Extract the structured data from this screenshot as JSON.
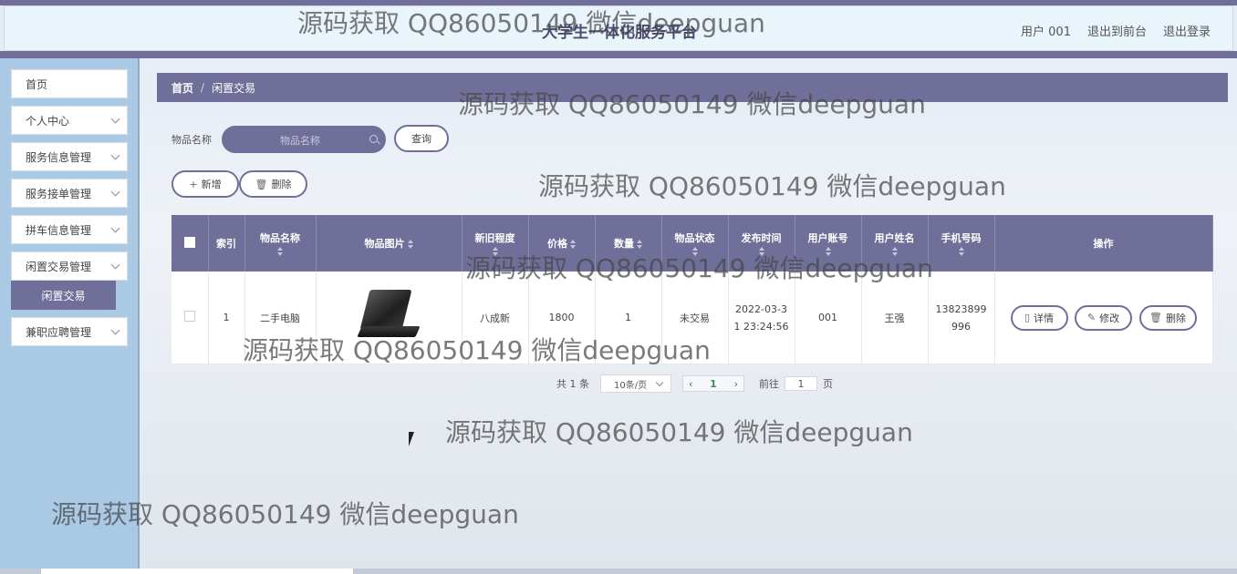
{
  "header": {
    "app_title": "大学生一体化服务平台",
    "user_label": "用户 001",
    "back_to_front": "退出到前台",
    "logout": "退出登录"
  },
  "sidebar": {
    "items": [
      {
        "label": "首页"
      },
      {
        "label": "个人中心"
      },
      {
        "label": "服务信息管理"
      },
      {
        "label": "服务接单管理"
      },
      {
        "label": "拼车信息管理"
      },
      {
        "label": "闲置交易管理"
      },
      {
        "label": "兼职应聘管理"
      }
    ],
    "active_sub": "闲置交易"
  },
  "breadcrumb": {
    "home": "首页",
    "separator": "/",
    "current": "闲置交易"
  },
  "search": {
    "label": "物品名称",
    "placeholder": "物品名称",
    "button": "查询"
  },
  "toolbar": {
    "add": "新增",
    "delete": "删除"
  },
  "table": {
    "columns": [
      "索引",
      "物品名称",
      "物品图片",
      "新旧程度",
      "价格",
      "数量",
      "物品状态",
      "发布时间",
      "用户账号",
      "用户姓名",
      "手机号码",
      "操作"
    ],
    "rows": [
      {
        "index": "1",
        "name": "二手电脑",
        "image": "laptop",
        "condition": "八成新",
        "price": "1800",
        "quantity": "1",
        "status": "未交易",
        "time_a": "2022-03-3",
        "time_b": "1 23:24:56",
        "account": "001",
        "username": "王强",
        "phone_a": "13823899",
        "phone_b": "996",
        "actions": {
          "detail": "详情",
          "edit": "修改",
          "delete": "删除"
        }
      }
    ]
  },
  "pagination": {
    "total": "共 1 条",
    "page_size": "10条/页",
    "prev": "‹",
    "current_page": "1",
    "next": "›",
    "goto_label": "前往",
    "goto_value": "1",
    "page_unit": "页"
  },
  "watermark": {
    "text": "源码获取 QQ86050149 微信deepguan"
  },
  "colors": {
    "accent": "#6f6f99",
    "sidebar": "#a9c9e4"
  }
}
